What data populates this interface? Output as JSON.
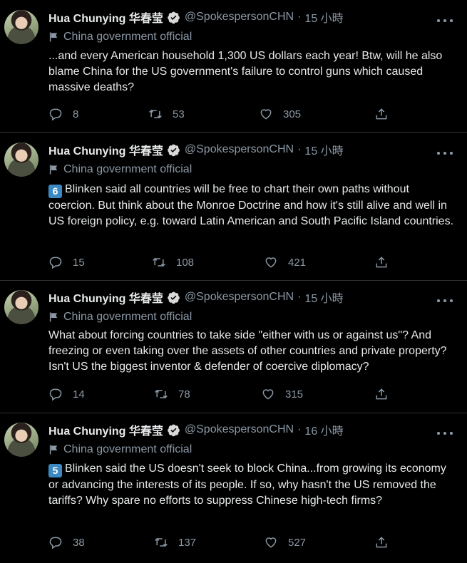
{
  "tweets": [
    {
      "name": "Hua Chunying 华春莹",
      "handle": "@SpokespersonCHN",
      "time": "15 小時",
      "label": "China government official",
      "emoji": "",
      "text": "...and every American household 1,300 US dollars each year! Btw, will he also blame China for the US government's failure to control guns which caused massive deaths?",
      "replies": "8",
      "retweets": "53",
      "likes": "305"
    },
    {
      "name": "Hua Chunying 华春莹",
      "handle": "@SpokespersonCHN",
      "time": "15 小時",
      "label": "China government official",
      "emoji": "6",
      "text": "Blinken said all countries will be free to chart their own paths without coercion. But think about the Monroe Doctrine and how it's still alive and well in US foreign policy, e.g. toward Latin American and South Pacific Island countries.",
      "replies": "15",
      "retweets": "108",
      "likes": "421"
    },
    {
      "name": "Hua Chunying 华春莹",
      "handle": "@SpokespersonCHN",
      "time": "15 小時",
      "label": "China government official",
      "emoji": "",
      "text": "What about forcing countries to take side \"either with us or against us\"? And freezing or even taking over the assets of other countries and private property? Isn't US  the biggest inventor & defender of coercive diplomacy?",
      "replies": "14",
      "retweets": "78",
      "likes": "315"
    },
    {
      "name": "Hua Chunying 华春莹",
      "handle": "@SpokespersonCHN",
      "time": "16 小時",
      "label": "China government official",
      "emoji": "5",
      "text": "Blinken said the US doesn't seek to block China...from growing its economy or advancing the interests of its people. If so, why hasn't the US removed the tariffs? Why spare no efforts to suppress Chinese high-tech firms?",
      "replies": "38",
      "retweets": "137",
      "likes": "527"
    }
  ],
  "colors": {
    "background": "#000000",
    "text": "#e7e9ea",
    "muted": "#8b98a5",
    "divider": "#2f3336",
    "verified": "#1d9bf0"
  }
}
